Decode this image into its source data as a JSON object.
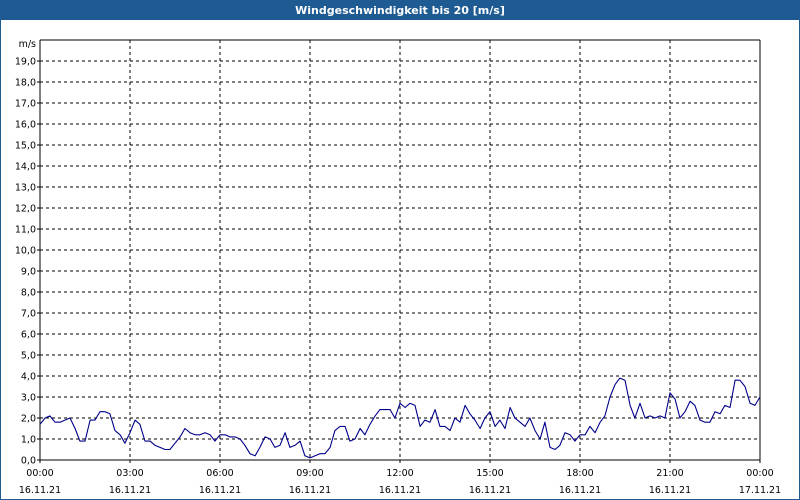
{
  "window": {
    "title": "Windgeschwindigkeit bis 20 [m/s]"
  },
  "colors": {
    "title_bar": "#1e5b92",
    "series_line": "#00008b",
    "grid": "#000000"
  },
  "chart_data": {
    "type": "line",
    "title": "Windgeschwindigkeit bis 20 [m/s]",
    "ylabel": "m/s",
    "xlabel": "",
    "ylim": [
      0,
      20
    ],
    "xlim": [
      0,
      24
    ],
    "grid": true,
    "y_ticks": [
      "0,0",
      "1,0",
      "2,0",
      "3,0",
      "4,0",
      "5,0",
      "6,0",
      "7,0",
      "8,0",
      "9,0",
      "10,0",
      "11,0",
      "12,0",
      "13,0",
      "14,0",
      "15,0",
      "16,0",
      "17,0",
      "18,0",
      "19,0"
    ],
    "x_ticks": [
      {
        "time": "00:00",
        "date": "16.11.21"
      },
      {
        "time": "03:00",
        "date": "16.11.21"
      },
      {
        "time": "06:00",
        "date": "16.11.21"
      },
      {
        "time": "09:00",
        "date": "16.11.21"
      },
      {
        "time": "12:00",
        "date": "16.11.21"
      },
      {
        "time": "15:00",
        "date": "16.11.21"
      },
      {
        "time": "18:00",
        "date": "16.11.21"
      },
      {
        "time": "21:00",
        "date": "16.11.21"
      },
      {
        "time": "00:00",
        "date": "17.11.21"
      }
    ],
    "series": [
      {
        "x": [
          0.0,
          0.17,
          0.33,
          0.5,
          0.67,
          0.83,
          1.0,
          1.17,
          1.33,
          1.5,
          1.67,
          1.83,
          2.0,
          2.17,
          2.33,
          2.5,
          2.67,
          2.83,
          3.0,
          3.17,
          3.33,
          3.5,
          3.67,
          3.83,
          4.0,
          4.17,
          4.33,
          4.5,
          4.67,
          4.83,
          5.0,
          5.17,
          5.33,
          5.5,
          5.67,
          5.83,
          6.0,
          6.17,
          6.33,
          6.5,
          6.67,
          6.83,
          7.0,
          7.17,
          7.33,
          7.5,
          7.67,
          7.83,
          8.0,
          8.17,
          8.33,
          8.5,
          8.67,
          8.83,
          9.0,
          9.17,
          9.33,
          9.5,
          9.67,
          9.83,
          10.0,
          10.17,
          10.33,
          10.5,
          10.67,
          10.83,
          11.0,
          11.17,
          11.33,
          11.5,
          11.67,
          11.83,
          12.0,
          12.17,
          12.33,
          12.5,
          12.67,
          12.83,
          13.0,
          13.17,
          13.33,
          13.5,
          13.67,
          13.83,
          14.0,
          14.17,
          14.33,
          14.5,
          14.67,
          14.83,
          15.0,
          15.17,
          15.33,
          15.5,
          15.67,
          15.83,
          16.0,
          16.17,
          16.33,
          16.5,
          16.67,
          16.83,
          17.0,
          17.17,
          17.33,
          17.5,
          17.67,
          17.83,
          18.0,
          18.17,
          18.33,
          18.5,
          18.67,
          18.83,
          19.0,
          19.17,
          19.33,
          19.5,
          19.67,
          19.83,
          20.0,
          20.17,
          20.33,
          20.5,
          20.67,
          20.83,
          21.0,
          21.17,
          21.33,
          21.5,
          21.67,
          21.83,
          22.0,
          22.17,
          22.33,
          22.5,
          22.67,
          22.83,
          23.0,
          23.17,
          23.33,
          23.5,
          23.67,
          23.83,
          24.0
        ],
        "y": [
          1.7,
          2.0,
          2.1,
          1.8,
          1.8,
          1.9,
          2.0,
          1.5,
          0.9,
          0.9,
          1.9,
          1.9,
          2.3,
          2.3,
          2.2,
          1.4,
          1.2,
          0.8,
          1.3,
          1.9,
          1.7,
          0.9,
          0.9,
          0.7,
          0.6,
          0.5,
          0.5,
          0.8,
          1.1,
          1.5,
          1.3,
          1.2,
          1.2,
          1.3,
          1.2,
          0.9,
          1.2,
          1.2,
          1.1,
          1.1,
          1.0,
          0.7,
          0.3,
          0.2,
          0.6,
          1.1,
          1.0,
          0.6,
          0.7,
          1.3,
          0.6,
          0.7,
          0.9,
          0.2,
          0.1,
          0.2,
          0.3,
          0.3,
          0.6,
          1.4,
          1.6,
          1.6,
          0.9,
          1.0,
          1.5,
          1.2,
          1.7,
          2.1,
          2.4,
          2.4,
          2.4,
          2.0,
          2.7,
          2.5,
          2.7,
          2.6,
          1.6,
          1.9,
          1.8,
          2.4,
          1.6,
          1.6,
          1.4,
          2.0,
          1.8,
          2.6,
          2.2,
          1.9,
          1.5,
          2.0,
          2.3,
          1.6,
          1.9,
          1.5,
          2.5,
          2.0,
          1.8,
          1.6,
          2.0,
          1.4,
          1.0,
          1.8,
          0.6,
          0.5,
          0.7,
          1.3,
          1.2,
          0.9,
          1.2,
          1.2,
          1.6,
          1.3,
          1.8,
          2.1,
          3.0,
          3.6,
          3.9,
          3.8,
          2.6,
          2.0,
          2.7,
          2.0,
          2.1,
          2.0,
          2.1,
          2.0,
          3.2,
          2.9,
          2.0,
          2.3,
          2.8,
          2.6,
          1.9,
          1.8,
          1.8,
          2.3,
          2.2,
          2.6,
          2.5,
          3.8,
          3.8,
          3.5,
          2.7,
          2.6,
          3.0
        ]
      }
    ]
  }
}
